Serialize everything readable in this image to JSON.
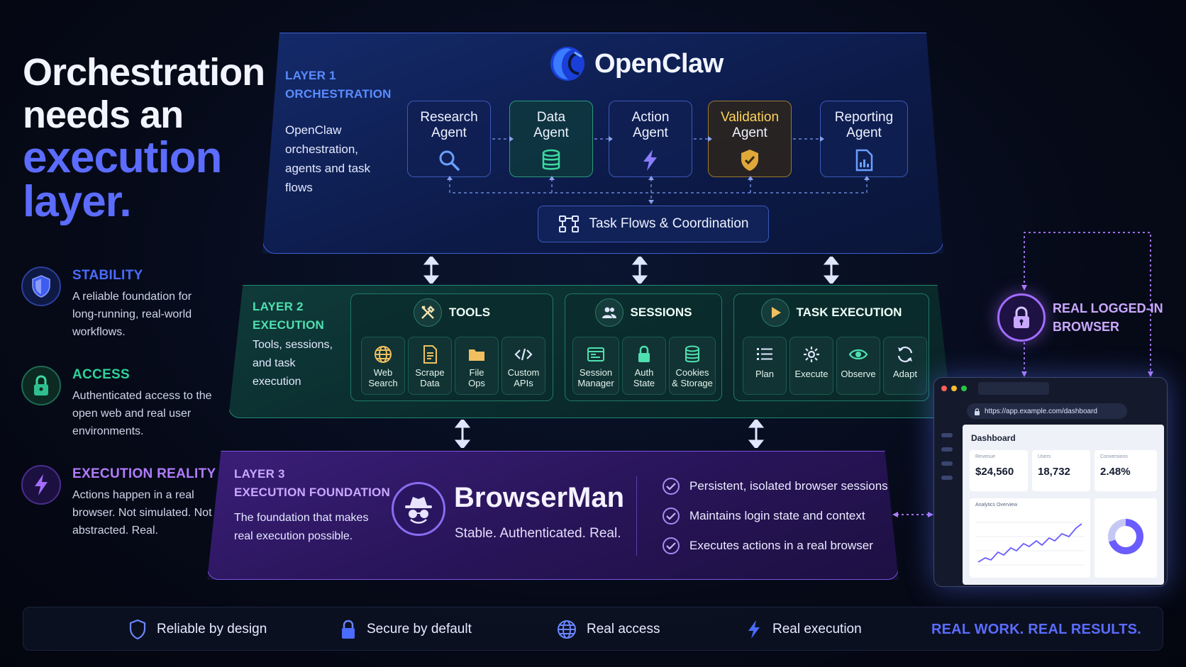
{
  "headline": {
    "line1": "Orchestration",
    "line2": "needs an",
    "line3": "execution",
    "line4": "layer."
  },
  "pillars": [
    {
      "title": "STABILITY",
      "desc": "A reliable foundation for long-running, real-world workflows.",
      "icon": "shield-icon",
      "color": "#4a6cff"
    },
    {
      "title": "ACCESS",
      "desc": "Authenticated access to the open web and real user environments.",
      "icon": "lock-icon",
      "color": "#2fbf8f"
    },
    {
      "title": "EXECUTION REALITY",
      "desc": "Actions happen in a real browser. Not simulated. Not abstracted. Real.",
      "icon": "lightning-icon",
      "color": "#a26cff"
    }
  ],
  "layer1": {
    "tag_line1": "LAYER 1",
    "tag_line2": "ORCHESTRATION",
    "desc": "OpenClaw orchestration, agents and task flows",
    "brand": "OpenClaw",
    "agents": [
      {
        "line1": "Research",
        "line2": "Agent",
        "icon": "search-icon"
      },
      {
        "line1": "Data",
        "line2": "Agent",
        "icon": "database-icon"
      },
      {
        "line1": "Action",
        "line2": "Agent",
        "icon": "lightning-icon"
      },
      {
        "line1": "Validation",
        "line2": "Agent",
        "icon": "shield-icon"
      },
      {
        "line1": "Reporting",
        "line2": "Agent",
        "icon": "report-icon"
      }
    ],
    "taskflows": "Task Flows & Coordination"
  },
  "layer2": {
    "tag_line1": "LAYER 2",
    "tag_line2": "EXECUTION",
    "desc": "Tools, sessions, and task execution",
    "groups": [
      {
        "title": "TOOLS",
        "icon": "tools-icon",
        "items": [
          {
            "line1": "Web",
            "line2": "Search",
            "icon": "globe-icon"
          },
          {
            "line1": "Scrape",
            "line2": "Data",
            "icon": "document-icon"
          },
          {
            "line1": "File",
            "line2": "Ops",
            "icon": "folder-icon"
          },
          {
            "line1": "Custom",
            "line2": "APIs",
            "icon": "code-icon"
          }
        ]
      },
      {
        "title": "SESSIONS",
        "icon": "users-icon",
        "items": [
          {
            "line1": "Session",
            "line2": "Manager",
            "icon": "window-icon"
          },
          {
            "line1": "Auth",
            "line2": "State",
            "icon": "lock-icon"
          },
          {
            "line1": "Cookies",
            "line2": "& Storage",
            "icon": "database-icon"
          }
        ]
      },
      {
        "title": "TASK EXECUTION",
        "icon": "play-icon",
        "items": [
          {
            "line1": "Plan",
            "line2": "",
            "icon": "list-icon"
          },
          {
            "line1": "Execute",
            "line2": "",
            "icon": "gear-icon"
          },
          {
            "line1": "Observe",
            "line2": "",
            "icon": "eye-icon"
          },
          {
            "line1": "Adapt",
            "line2": "",
            "icon": "refresh-icon"
          }
        ]
      }
    ]
  },
  "layer3": {
    "tag_line1": "LAYER 3",
    "tag_line2": "EXECUTION FOUNDATION",
    "desc": "The foundation that makes real execution possible.",
    "brand": "BrowserMan",
    "tagline": "Stable. Authenticated. Real.",
    "checks": [
      "Persistent, isolated browser sessions",
      "Maintains login state and context",
      "Executes actions in a real browser"
    ]
  },
  "browser": {
    "label_line1": "REAL LOGGED-IN",
    "label_line2": "BROWSER",
    "url": "https://app.example.com/dashboard",
    "dashboard_title": "Dashboard",
    "metrics": [
      {
        "label": "Revenue",
        "value": "$24,560"
      },
      {
        "label": "Users",
        "value": "18,732"
      },
      {
        "label": "Conversions",
        "value": "2.48%"
      }
    ],
    "chart_title": "Analytics Overview"
  },
  "footer": {
    "items": [
      {
        "label": "Reliable by design",
        "icon": "shield-icon"
      },
      {
        "label": "Secure by default",
        "icon": "lock-icon"
      },
      {
        "label": "Real access",
        "icon": "globe-icon"
      },
      {
        "label": "Real execution",
        "icon": "lightning-icon"
      }
    ],
    "slogan": "REAL WORK. REAL RESULTS."
  },
  "colors": {
    "accent_blue": "#5b6cff",
    "accent_green": "#2fbf8f",
    "accent_purple": "#a26cff",
    "layer1_tag": "#5b8cff",
    "layer2_tag": "#4fe0b0",
    "layer3_tag": "#c9a8ff"
  }
}
